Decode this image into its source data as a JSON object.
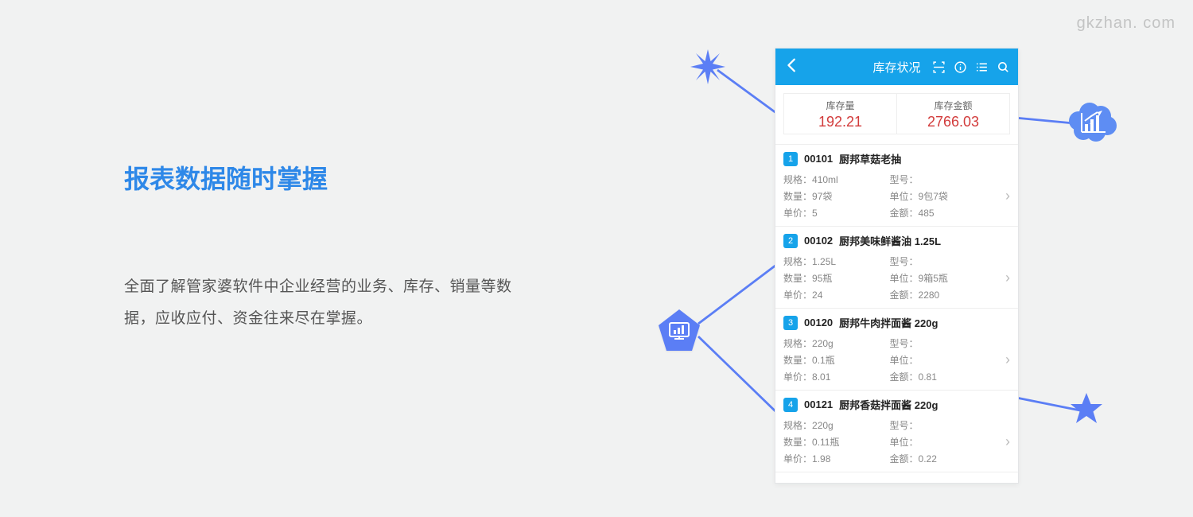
{
  "watermark": "gkzhan. com",
  "headline": "报表数据随时掌握",
  "body": "全面了解管家婆软件中企业经营的业务、库存、销量等数据，应收应付、资金往来尽在掌握。",
  "phone": {
    "title": "库存状况",
    "summary": {
      "qty_label": "库存量",
      "qty_value": "192.21",
      "amount_label": "库存金额",
      "amount_value": "2766.03"
    },
    "field_labels": {
      "spec": "规格：",
      "model": "型号：",
      "qty": "数量：",
      "unit": "单位：",
      "price": "单价：",
      "amount": "金额："
    },
    "items": [
      {
        "idx": "1",
        "code": "00101",
        "name": "厨邦草菇老抽",
        "spec": "410ml",
        "model": "",
        "qty": "97袋",
        "unit": "9包7袋",
        "price": "5",
        "amount": "485"
      },
      {
        "idx": "2",
        "code": "00102",
        "name": "厨邦美味鲜酱油 1.25L",
        "spec": "1.25L",
        "model": "",
        "qty": "95瓶",
        "unit": "9箱5瓶",
        "price": "24",
        "amount": "2280"
      },
      {
        "idx": "3",
        "code": "00120",
        "name": "厨邦牛肉拌面酱 220g",
        "spec": "220g",
        "model": "",
        "qty": "0.1瓶",
        "unit": "",
        "price": "8.01",
        "amount": "0.81"
      },
      {
        "idx": "4",
        "code": "00121",
        "name": "厨邦香菇拌面酱 220g",
        "spec": "220g",
        "model": "",
        "qty": "0.11瓶",
        "unit": "",
        "price": "1.98",
        "amount": "0.22"
      }
    ]
  }
}
